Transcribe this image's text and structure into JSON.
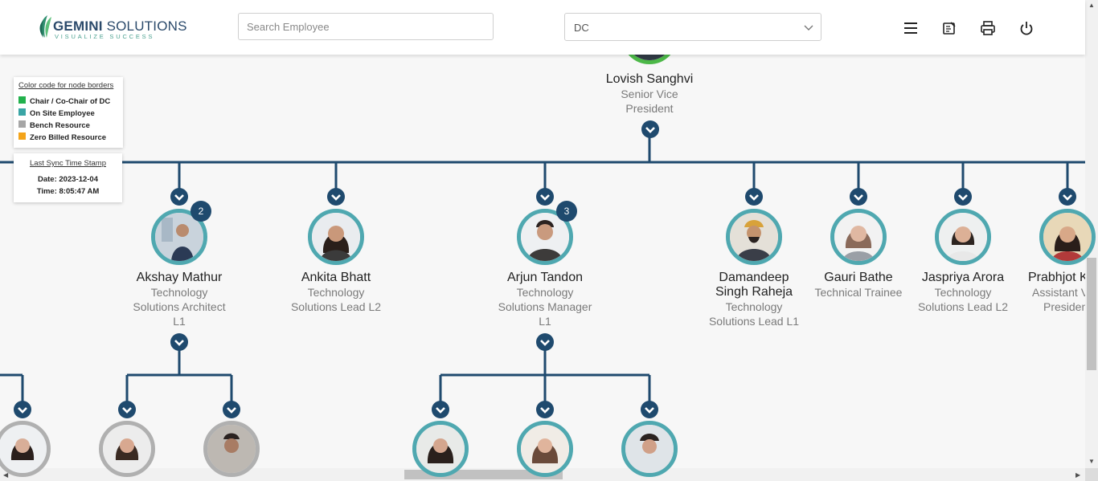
{
  "header": {
    "logo_main": "GEMINI",
    "logo_sub": "SOLUTIONS",
    "logo_tagline": "VISUALIZE SUCCESS",
    "search_placeholder": "Search Employee",
    "dropdown_value": "DC",
    "icons": [
      "menu-icon",
      "note-edit-icon",
      "printer-icon",
      "power-icon"
    ]
  },
  "legend": {
    "title": "Color code for node borders",
    "items": [
      {
        "label": "Chair / Co-Chair of DC",
        "color": "#22b14c"
      },
      {
        "label": "On Site Employee",
        "color": "#3aa5a5"
      },
      {
        "label": "Bench Resource",
        "color": "#a6a6a6"
      },
      {
        "label": "Zero Billed Resource",
        "color": "#f4a41a"
      }
    ]
  },
  "sync": {
    "title": "Last Sync Time Stamp",
    "date": "Date: 2023-12-04",
    "time": "Time: 8:05:47 AM"
  },
  "colors": {
    "connector": "#1f4a6e",
    "border_default": "#4fa8b0",
    "border_chair": "#4cb848",
    "border_bench": "#b0b0b0"
  },
  "root": {
    "name": "Lovish Sanghvi",
    "designation_line1": "Senior Vice",
    "designation_line2": "President"
  },
  "children": [
    {
      "name": "Akshay Mathur",
      "designation": [
        "Technology",
        "Solutions Architect",
        "L1"
      ],
      "count": "2",
      "avatar": "avatar-akshay"
    },
    {
      "name": "Ankita Bhatt",
      "designation": [
        "Technology",
        "Solutions Lead L2"
      ],
      "avatar": "avatar-ankita"
    },
    {
      "name": "Arjun Tandon",
      "designation": [
        "Technology",
        "Solutions Manager",
        "L1"
      ],
      "count": "3",
      "avatar": "avatar-arjun"
    },
    {
      "name": [
        "Damandeep",
        "Singh Raheja"
      ],
      "designation": [
        "Technology",
        "Solutions Lead L1"
      ],
      "avatar": "avatar-damandeep"
    },
    {
      "name": "Gauri Bathe",
      "designation": [
        "Technical Trainee"
      ],
      "avatar": "avatar-gauri"
    },
    {
      "name": "Jaspriya Arora",
      "designation": [
        "Technology",
        "Solutions Lead L2"
      ],
      "avatar": "avatar-jaspriya"
    },
    {
      "name": "Prabhjot K",
      "designation": [
        "Assistant V",
        "Presiden"
      ],
      "avatar": "avatar-prabhjot"
    }
  ]
}
